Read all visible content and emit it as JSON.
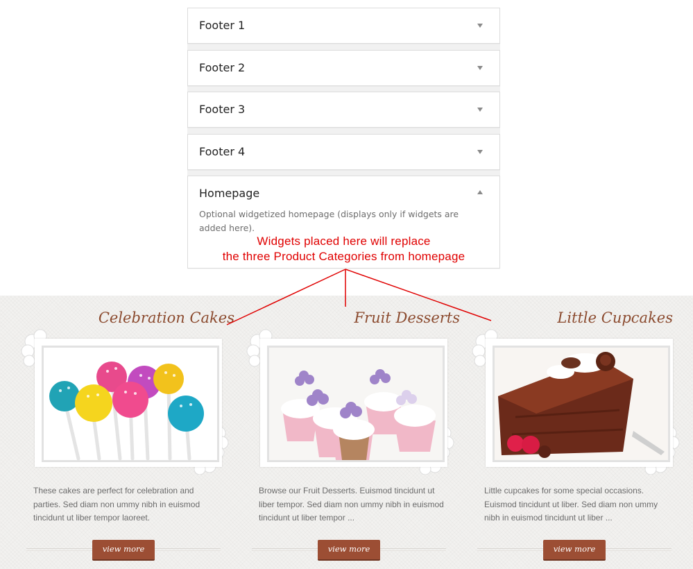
{
  "widget_areas": [
    {
      "title": "Footer 1",
      "expanded": false
    },
    {
      "title": "Footer 2",
      "expanded": false
    },
    {
      "title": "Footer 3",
      "expanded": false
    },
    {
      "title": "Footer 4",
      "expanded": false
    },
    {
      "title": "Homepage",
      "expanded": true,
      "description": "Optional widgetized homepage (displays only if widgets are added here)."
    }
  ],
  "annotation": {
    "line1": "Widgets placed here will replace",
    "line2": "the three Product Categories from homepage",
    "color": "#e00000"
  },
  "categories": [
    {
      "title": "Celebration Cakes",
      "description": "These cakes are perfect for celebration and parties. Sed diam non ummy nibh in euismod tincidunt ut liber tempor laoreet.",
      "button": "view more",
      "image": "cake-pops-image"
    },
    {
      "title": "Fruit Desserts",
      "description": "Browse our Fruit Desserts. Euismod tincidunt ut liber tempor. Sed diam non ummy nibh in euismod tincidunt ut liber tempor ...",
      "button": "view more",
      "image": "cupcakes-image"
    },
    {
      "title": "Little Cupcakes",
      "description": "Little cupcakes for some special occasions. Euismod tincidunt ut liber. Sed diam non ummy nibh in euismod tincidunt ut liber ...",
      "button": "view more",
      "image": "chocolate-cake-image"
    }
  ],
  "colors": {
    "accent": "#9c4e34",
    "title_brown": "#8b4a2e",
    "annotation_red": "#e00000"
  }
}
